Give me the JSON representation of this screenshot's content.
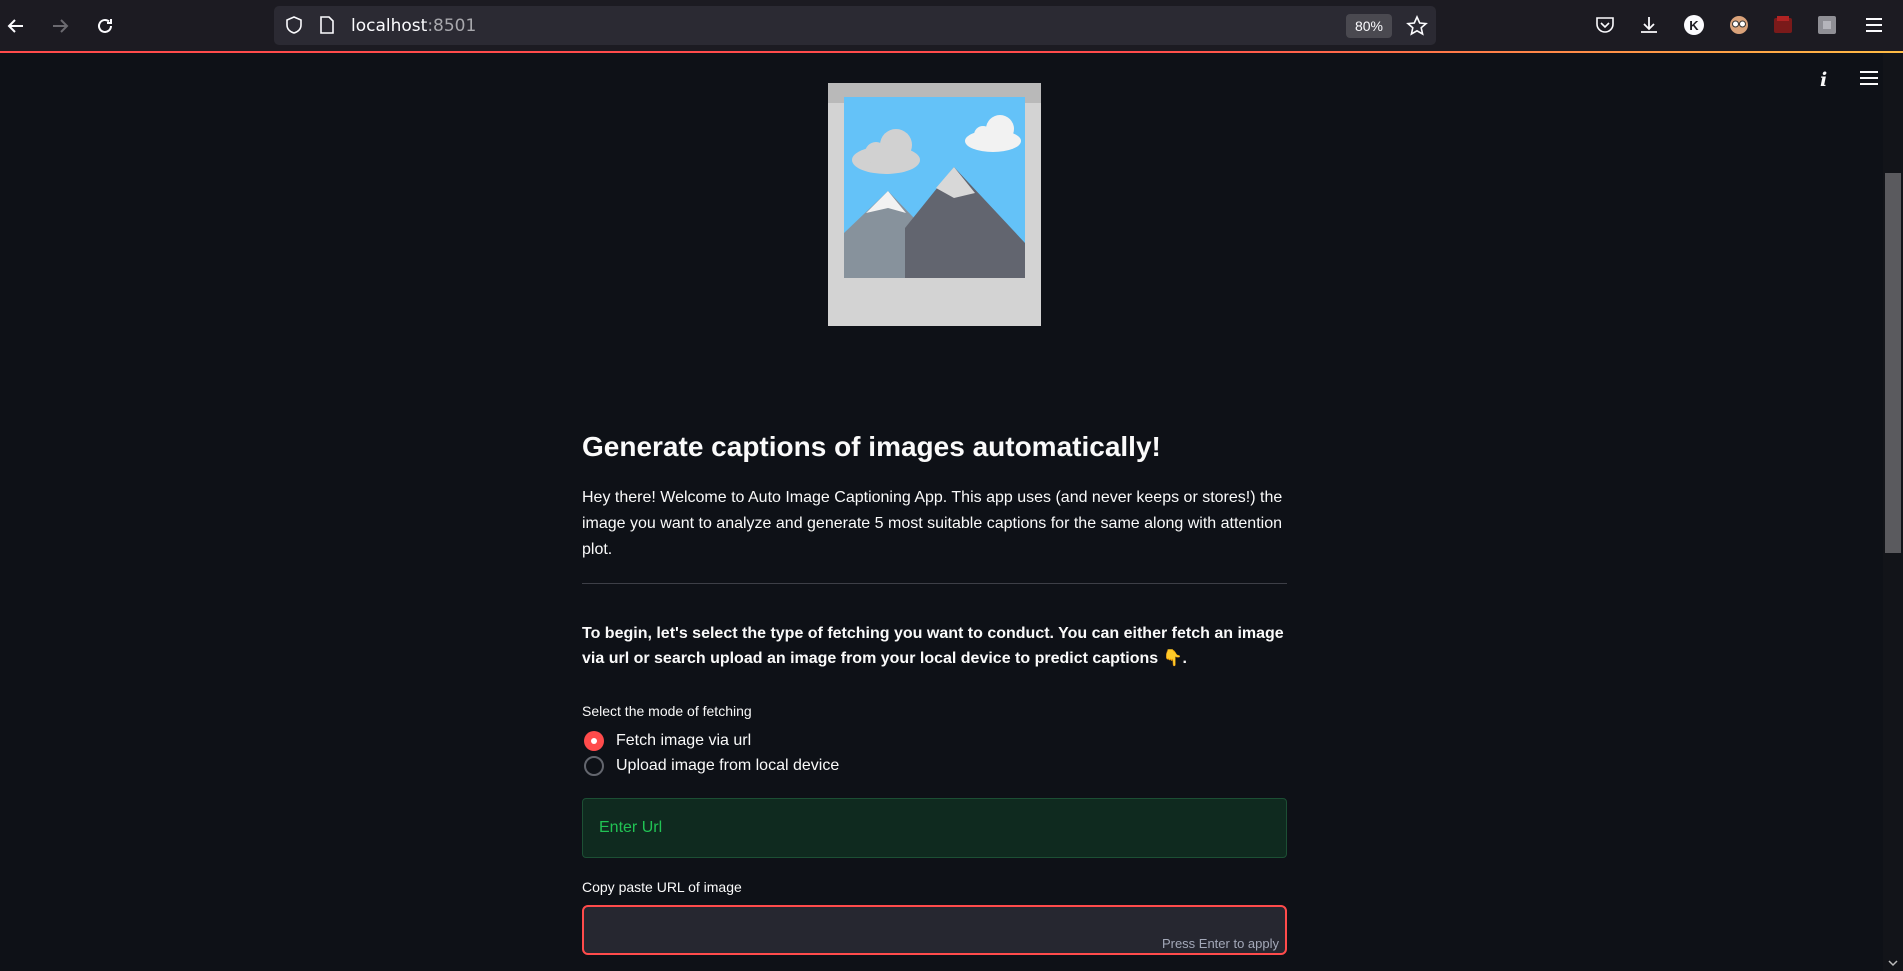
{
  "browser": {
    "url_host": "localhost",
    "url_port": ":8501",
    "zoom": "80%",
    "profile_initial": "K"
  },
  "app": {
    "title": "Generate captions of images automatically!",
    "intro": "Hey there! Welcome to Auto Image Captioning App. This app uses (and never keeps or stores!) the image you want to analyze and generate 5 most suitable captions for the same along with attention plot.",
    "begin_text": "To begin, let's select the type of fetching you want to conduct. You can either fetch an image via url or search upload an image from your local device to predict captions 👇.",
    "radio": {
      "label": "Select the mode of fetching",
      "options": [
        "Fetch image via url",
        "Upload image from local device"
      ],
      "selected": "Fetch image via url"
    },
    "success_message": "Enter Url",
    "url_input": {
      "label": "Copy paste URL of image",
      "value": "",
      "hint": "Press Enter to apply"
    }
  },
  "colors": {
    "accent": "#ff4b4b",
    "success_text": "#21c354",
    "background": "#0e1117"
  }
}
